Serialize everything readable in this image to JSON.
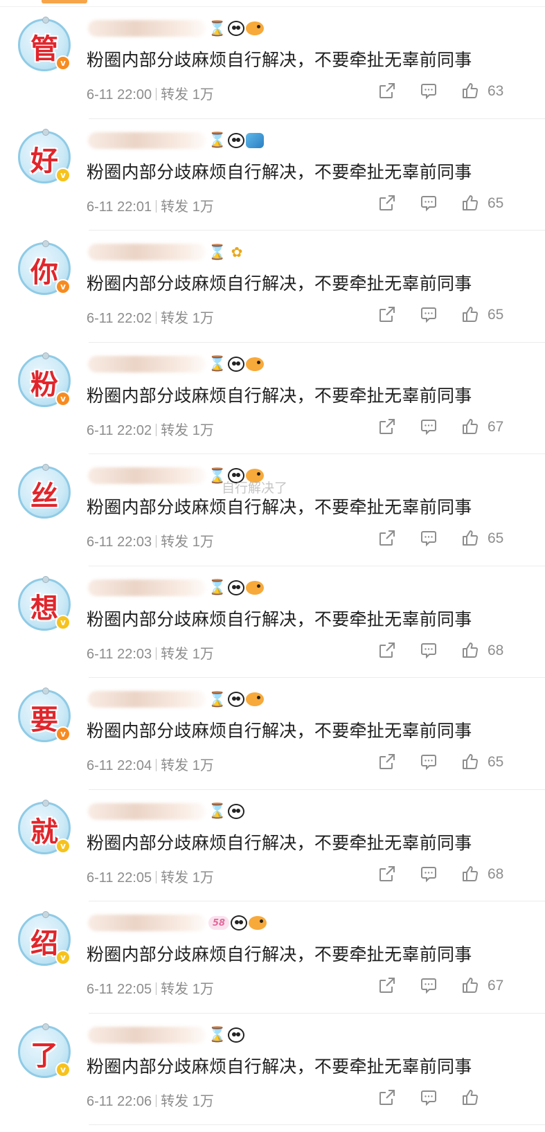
{
  "comment_text": "粉圈内部分歧麻烦自行解决，不要牵扯无辜前同事",
  "repost_label": "转发",
  "repost_count": "1万",
  "comments": [
    {
      "avatar_char": "管",
      "time": "6-11 22:00",
      "likes": "63",
      "badge": "orange",
      "emojis": [
        "hourglass",
        "panda",
        "fish"
      ]
    },
    {
      "avatar_char": "好",
      "time": "6-11 22:01",
      "likes": "65",
      "badge": "gold",
      "emojis": [
        "hourglass",
        "panda",
        "shark"
      ]
    },
    {
      "avatar_char": "你",
      "time": "6-11 22:02",
      "likes": "65",
      "badge": "orange",
      "emojis": [
        "hourglass",
        "flower"
      ]
    },
    {
      "avatar_char": "粉",
      "time": "6-11 22:02",
      "likes": "67",
      "badge": "orange",
      "emojis": [
        "hourglass",
        "panda",
        "fish"
      ]
    },
    {
      "avatar_char": "丝",
      "time": "6-11 22:03",
      "likes": "65",
      "badge": "none",
      "emojis": [
        "hourglass",
        "panda",
        "fish"
      ]
    },
    {
      "avatar_char": "想",
      "time": "6-11 22:03",
      "likes": "68",
      "badge": "gold",
      "emojis": [
        "hourglass",
        "panda",
        "fish"
      ]
    },
    {
      "avatar_char": "要",
      "time": "6-11 22:04",
      "likes": "65",
      "badge": "orange",
      "emojis": [
        "hourglass",
        "panda",
        "fish"
      ]
    },
    {
      "avatar_char": "就",
      "time": "6-11 22:05",
      "likes": "68",
      "badge": "gold",
      "emojis": [
        "hourglass",
        "panda"
      ]
    },
    {
      "avatar_char": "绍",
      "time": "6-11 22:05",
      "likes": "67",
      "badge": "gold",
      "emojis": [
        "badge58",
        "panda",
        "fish"
      ]
    },
    {
      "avatar_char": "了",
      "time": "6-11 22:06",
      "likes": "",
      "badge": "gold",
      "emojis": [
        "hourglass",
        "panda"
      ]
    }
  ],
  "badge58_text": "58",
  "emoji_glyphs": {
    "hourglass": "⌛",
    "flower": "✿"
  },
  "watermark_text": "自行解决了"
}
